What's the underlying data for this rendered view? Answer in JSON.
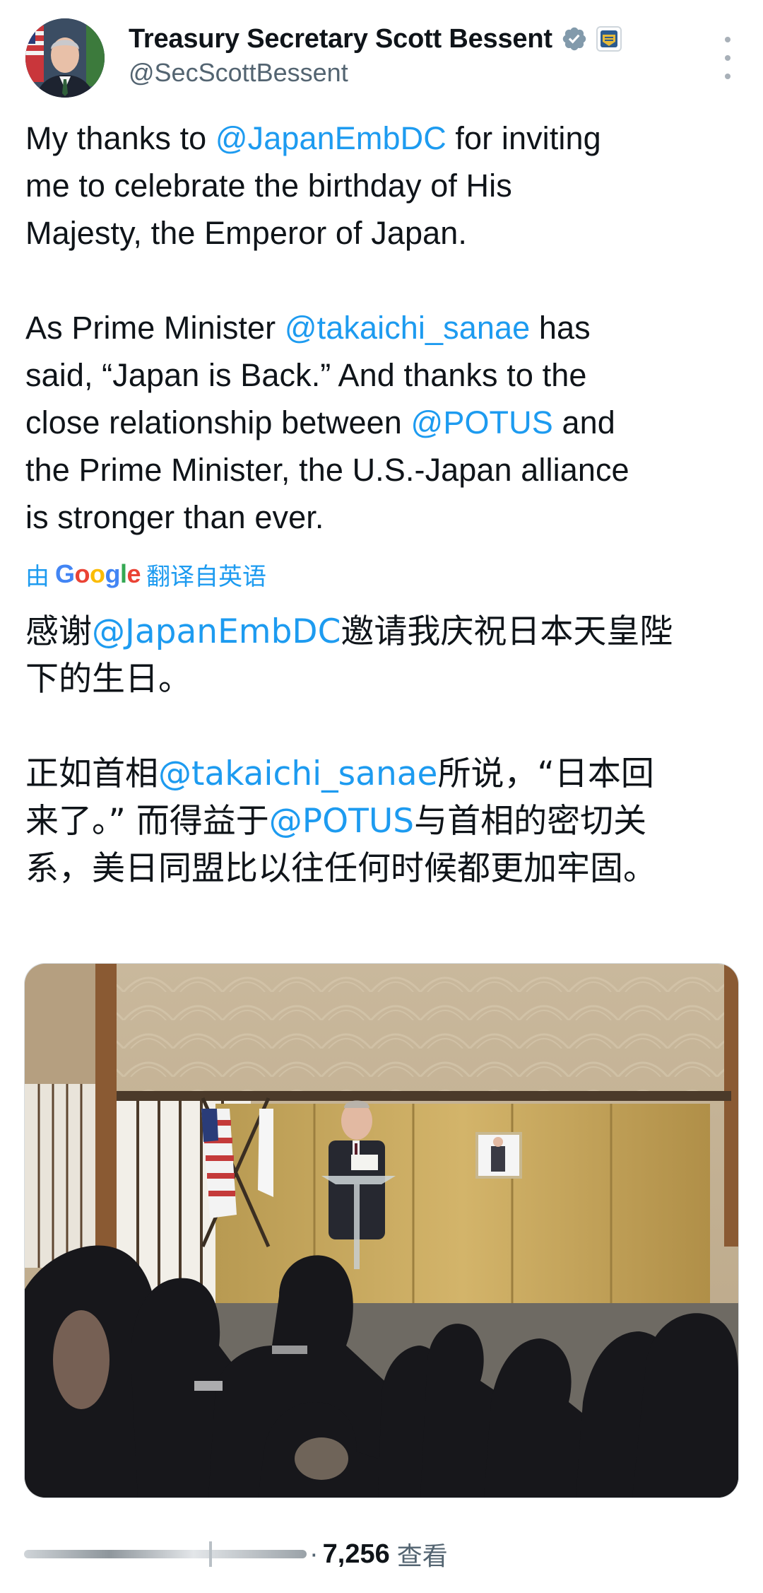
{
  "author": {
    "display_name": "Treasury Secretary Scott Bessent",
    "handle": "@SecScottBessent",
    "verified_icon": "verified-badge-icon",
    "affiliation_icon": "treasury-seal-icon"
  },
  "tweet": {
    "original": {
      "p1_a": "My thanks to ",
      "p1_mention": "@JapanEmbDC",
      "p1_b": " for inviting\nme to celebrate the birthday of His\nMajesty, the Emperor of Japan.\n\nAs Prime Minister ",
      "p2_mention": "@takaichi_sanae",
      "p2_b": " has\nsaid, “Japan is Back.” And thanks to the\nclose relationship between ",
      "p3_mention": "@POTUS",
      "p3_b": " and\nthe Prime Minister, the U.S.-Japan alliance\nis stronger than ever."
    },
    "translation_label": {
      "prefix": "由",
      "brand": "Google",
      "suffix": "翻译自英语"
    },
    "translated": {
      "t1_a": "感谢",
      "t1_mention": "@JapanEmbDC",
      "t1_b": "邀请我庆祝日本天皇陛\n下的生日。\n\n正如首相",
      "t2_mention": "@takaichi_sanae",
      "t2_b": "所说，“日本回\n来了。” 而得益于",
      "t3_mention": "@POTUS",
      "t3_b": "与首相的密切关\n系，美日同盟比以往任何时候都更加牢固。"
    }
  },
  "footer": {
    "separator": "·",
    "views_count": "7,256",
    "views_label": "查看"
  },
  "colors": {
    "link": "#1d9bf0",
    "text": "#0f1419",
    "secondary": "#536471"
  }
}
